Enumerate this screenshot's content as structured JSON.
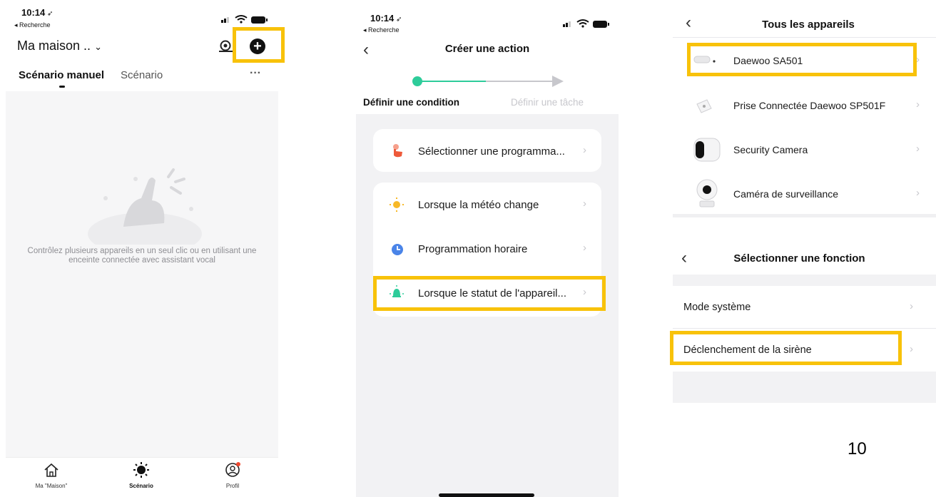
{
  "screen1": {
    "status_time": "10:14",
    "status_back": "◂ Recherche",
    "home_title": "Ma maison ..",
    "tabs": [
      "Scénario manuel",
      "Scénario"
    ],
    "empty_text": "Contrôlez plusieurs appareils en un seul clic ou en utilisant une enceinte connectée avec assistant vocal",
    "nav": [
      "Ma \"Maison\"",
      "Scénario",
      "Profil"
    ],
    "more": "···"
  },
  "screen2": {
    "status_time": "10:14",
    "status_back": "◂ Recherche",
    "title": "Créer une action",
    "step1": "Définir une condition",
    "step2": "Définir une tâche",
    "items": [
      "Sélectionner une programma...",
      "Lorsque la météo change",
      "Programmation horaire",
      "Lorsque le statut de l'appareil..."
    ],
    "colors": {
      "accent": "#2ecc9a",
      "highlight": "#f8c20a"
    }
  },
  "screen3": {
    "title": "Tous les appareils",
    "devices": [
      "Daewoo SA501",
      "Prise Connectée Daewoo SP501F",
      "Security Camera",
      "Caméra de surveillance"
    ],
    "function_title": "Sélectionner une fonction",
    "functions": [
      "Mode système",
      "Déclenchement de la sirène"
    ]
  },
  "page_number": "10"
}
